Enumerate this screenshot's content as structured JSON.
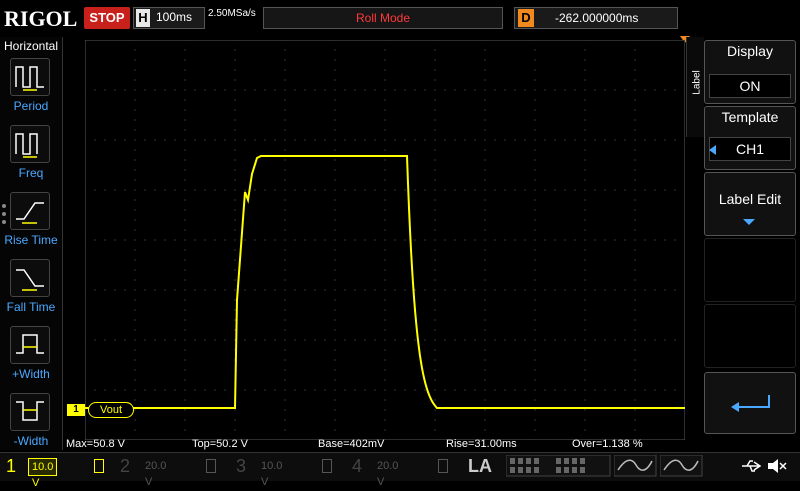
{
  "top": {
    "brand": "RIGOL",
    "run_state": "STOP",
    "timebase_key": "H",
    "timebase_value": "100ms",
    "sample_rate": "2.50MSa/s",
    "mode": "Roll Mode",
    "delay_key": "D",
    "delay_value": "-262.000000ms"
  },
  "left_menu": {
    "title": "Horizontal",
    "items": [
      {
        "label": "Period",
        "icon": "period-icon"
      },
      {
        "label": "Freq",
        "icon": "freq-icon"
      },
      {
        "label": "Rise Time",
        "icon": "rise-time-icon"
      },
      {
        "label": "Fall Time",
        "icon": "fall-time-icon"
      },
      {
        "label": "+Width",
        "icon": "positive-width-icon"
      },
      {
        "label": "-Width",
        "icon": "negative-width-icon"
      }
    ]
  },
  "right_menu": {
    "tab_label": "Label",
    "display": {
      "title": "Display",
      "value": "ON"
    },
    "template": {
      "title": "Template",
      "value": "CH1"
    },
    "label_edit": {
      "title": "Label Edit"
    }
  },
  "waveform": {
    "channel_marker": "1",
    "channel_label": "Vout",
    "color": "#ffff00"
  },
  "measurements": {
    "max": "Max=50.8 V",
    "top": "Top=50.2 V",
    "base": "Base=402mV",
    "rise": "Rise=31.00ms",
    "over": "Over=1.138 %"
  },
  "channels": [
    {
      "num": "1",
      "scale": "10.0 V",
      "color": "#ffff00",
      "active": true
    },
    {
      "num": "2",
      "scale": "20.0 V",
      "color": "#00e0ff",
      "active": false
    },
    {
      "num": "3",
      "scale": "10.0 V",
      "color": "#ff40ff",
      "active": false
    },
    {
      "num": "4",
      "scale": "20.0 V",
      "color": "#3a7bff",
      "active": false
    }
  ],
  "la": {
    "label": "LA"
  },
  "colors": {
    "accent_blue": "#4aa8ff",
    "stop_red": "#c8201a",
    "delay_orange": "#f18a1e",
    "roll_red": "#ff3a3a"
  }
}
